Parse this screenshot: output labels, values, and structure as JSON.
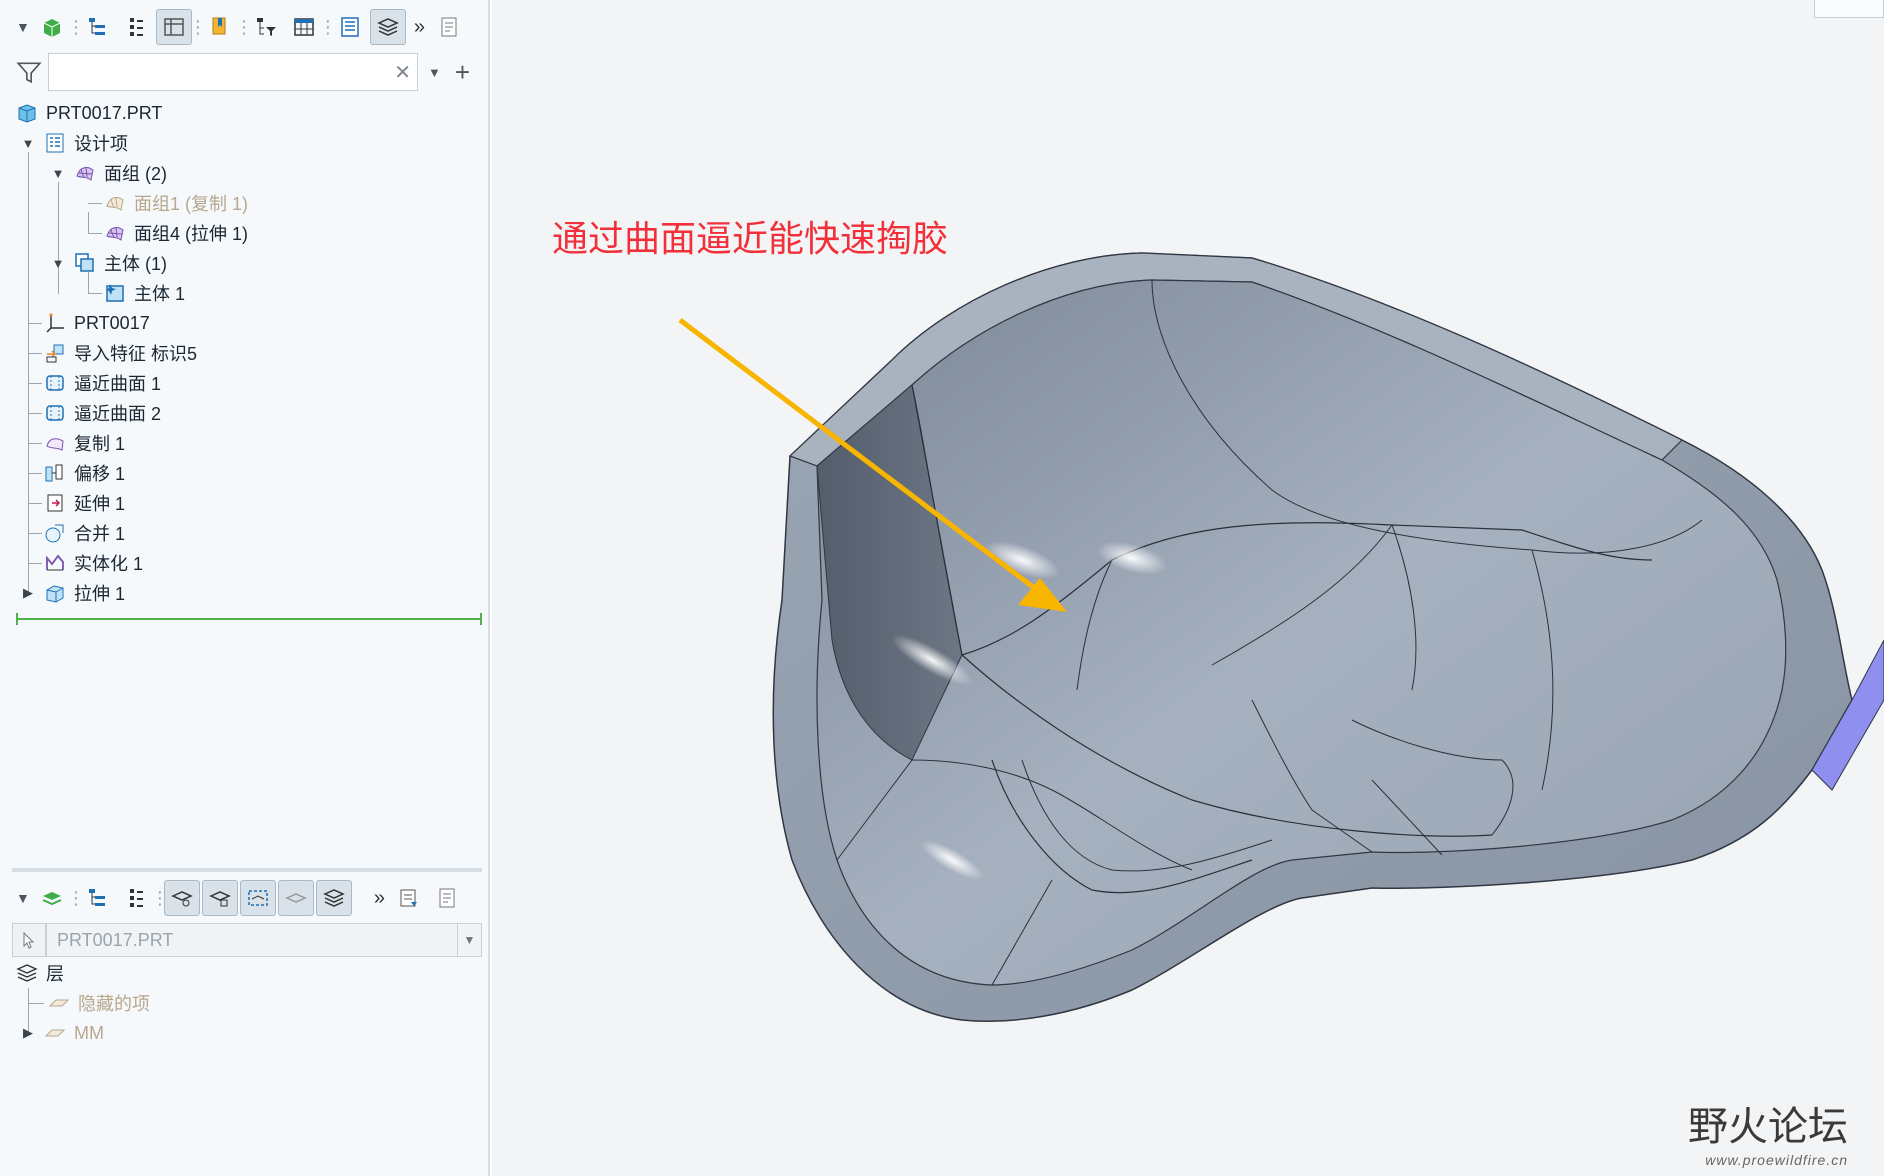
{
  "model_tree": {
    "search": {
      "value": "",
      "placeholder": ""
    },
    "items": [
      {
        "label": "PRT0017.PRT"
      },
      {
        "label": "设计项"
      },
      {
        "label": "面组 (2)"
      },
      {
        "label": "面组1 (复制 1)"
      },
      {
        "label": "面组4 (拉伸 1)"
      },
      {
        "label": "主体 (1)"
      },
      {
        "label": "主体 1"
      },
      {
        "label": "PRT0017"
      },
      {
        "label": "导入特征 标识5"
      },
      {
        "label": "逼近曲面 1"
      },
      {
        "label": "逼近曲面 2"
      },
      {
        "label": "复制 1"
      },
      {
        "label": "偏移 1"
      },
      {
        "label": "延伸 1"
      },
      {
        "label": "合并 1"
      },
      {
        "label": "实体化 1"
      },
      {
        "label": "拉伸 1"
      }
    ]
  },
  "layer_tree": {
    "selected_model": "PRT0017.PRT",
    "items": [
      {
        "label": "层"
      },
      {
        "label": "隐藏的项"
      },
      {
        "label": "MM"
      }
    ]
  },
  "viewport": {
    "annotation": "通过曲面逼近能快速掏胶",
    "watermark_title": "野火论坛",
    "watermark_url": "www.proewildfire.cn"
  },
  "colors": {
    "annotation": "#f2303a",
    "arrow": "#f7b500",
    "insert_line": "#4fb24a",
    "part_face": "#9aa6b4"
  },
  "icons": {
    "filter": "funnel-icon",
    "clear": "close-icon",
    "add": "plus-icon",
    "more": "double-chevron-right-icon"
  }
}
